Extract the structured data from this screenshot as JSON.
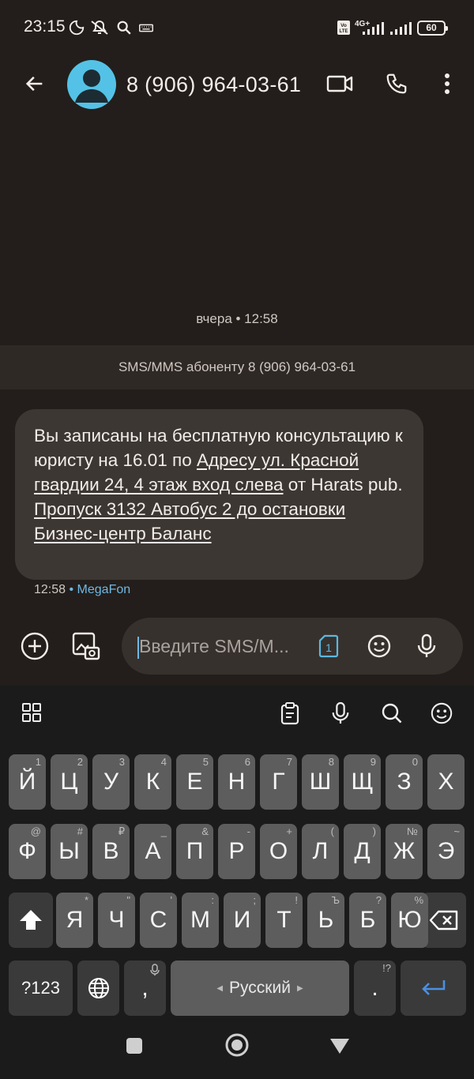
{
  "status_bar": {
    "time": "23:15",
    "network": "4G+",
    "volte": "Vo LTE",
    "battery": "60"
  },
  "header": {
    "contact": "8 (906) 964-03-61"
  },
  "conversation": {
    "date_separator": "вчера • 12:58",
    "recipient_banner": "SMS/MMS абоненту 8 (906) 964-03-61",
    "message": {
      "part1": "Вы записаны на бесплатную консультацию к юристу на 16.01 по ",
      "link1": "Адресу ул. Красной гвардии 24, 4 этаж вход слева",
      "part2": " от Harats pub. ",
      "link2": "Пропуск 3132 Автобус 2 до остановки Бизнес-центр Баланс",
      "time": "12:58",
      "sim": "MegaFon"
    }
  },
  "composer": {
    "placeholder": "Введите SMS/M...",
    "sim_slot": "1"
  },
  "keyboard": {
    "row1": [
      {
        "k": "Й",
        "h": "1"
      },
      {
        "k": "Ц",
        "h": "2"
      },
      {
        "k": "У",
        "h": "3"
      },
      {
        "k": "К",
        "h": "4"
      },
      {
        "k": "Е",
        "h": "5"
      },
      {
        "k": "Н",
        "h": "6"
      },
      {
        "k": "Г",
        "h": "7"
      },
      {
        "k": "Ш",
        "h": "8"
      },
      {
        "k": "Щ",
        "h": "9"
      },
      {
        "k": "З",
        "h": "0"
      },
      {
        "k": "Х",
        "h": ""
      }
    ],
    "row2": [
      {
        "k": "Ф",
        "h": "@"
      },
      {
        "k": "Ы",
        "h": "#"
      },
      {
        "k": "В",
        "h": "₽"
      },
      {
        "k": "А",
        "h": "_"
      },
      {
        "k": "П",
        "h": "&"
      },
      {
        "k": "Р",
        "h": "-"
      },
      {
        "k": "О",
        "h": "+"
      },
      {
        "k": "Л",
        "h": "("
      },
      {
        "k": "Д",
        "h": ")"
      },
      {
        "k": "Ж",
        "h": "№"
      },
      {
        "k": "Э",
        "h": "~"
      }
    ],
    "row3": [
      {
        "k": "Я",
        "h": "*"
      },
      {
        "k": "Ч",
        "h": "\""
      },
      {
        "k": "С",
        "h": "'"
      },
      {
        "k": "М",
        "h": ":"
      },
      {
        "k": "И",
        "h": ";"
      },
      {
        "k": "Т",
        "h": "!"
      },
      {
        "k": "Ь",
        "h": "Ъ"
      },
      {
        "k": "Б",
        "h": "?"
      },
      {
        "k": "Ю",
        "h": "%"
      }
    ],
    "num_key": "?123",
    "comma": ",",
    "space": "Русский",
    "period": ".",
    "period_hint": "!?"
  }
}
